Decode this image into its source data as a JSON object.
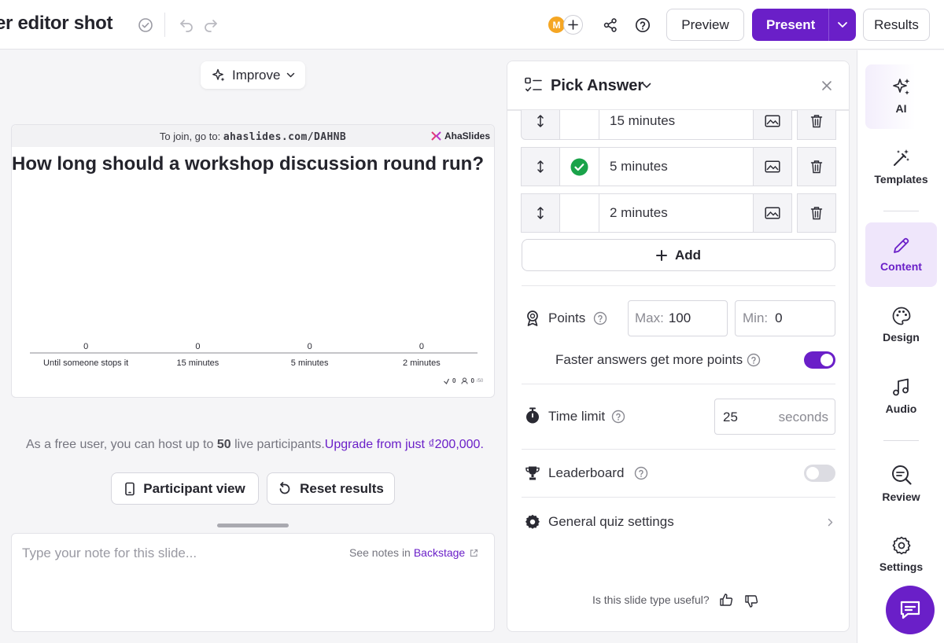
{
  "header": {
    "title": "er editor shot",
    "avatar_initial": "M",
    "preview_label": "Preview",
    "present_label": "Present",
    "results_label": "Results"
  },
  "editor": {
    "improve_label": "Improve",
    "slide": {
      "join_prefix": "To join, go to:",
      "join_url": "ahaslides.com/DAHNB",
      "brand": "AhaSlides",
      "question": "How long should a workshop discussion round run?",
      "stats_votes": "0",
      "stats_people": "0",
      "stats_people_max": "/50"
    },
    "free_note": {
      "prefix": "As a free user, you can host up to",
      "limit": "50",
      "suffix": "live participants.",
      "upgrade": "Upgrade from just ₫200,000."
    },
    "participant_view_label": "Participant view",
    "reset_results_label": "Reset results",
    "notes_placeholder": "Type your note for this slide...",
    "notes_hint": "See notes in",
    "notes_link": "Backstage"
  },
  "chart_data": {
    "type": "bar",
    "categories": [
      "Until someone stops it",
      "15 minutes",
      "5 minutes",
      "2 minutes"
    ],
    "values": [
      0,
      0,
      0,
      0
    ],
    "title": "How long should a workshop discussion round run?"
  },
  "panel": {
    "type_label": "Pick Answer",
    "options": [
      {
        "label": "15 minutes",
        "correct": false
      },
      {
        "label": "5 minutes",
        "correct": true
      },
      {
        "label": "2 minutes",
        "correct": false
      }
    ],
    "add_label": "Add",
    "points_label": "Points",
    "max_prefix": "Max:",
    "max_value": "100",
    "min_prefix": "Min:",
    "min_value": "0",
    "faster_label": "Faster answers get more points",
    "faster_enabled": true,
    "time_limit_label": "Time limit",
    "time_value": "25",
    "time_unit": "seconds",
    "leaderboard_label": "Leaderboard",
    "leaderboard_enabled": false,
    "general_label": "General quiz settings",
    "feedback_label": "Is this slide type useful?"
  },
  "sidebar": {
    "items": [
      {
        "label": "AI",
        "icon": "sparkles-icon"
      },
      {
        "label": "Templates",
        "icon": "magic-wand-icon"
      },
      {
        "label": "Content",
        "icon": "pencil-icon",
        "active": true
      },
      {
        "label": "Design",
        "icon": "palette-icon"
      },
      {
        "label": "Audio",
        "icon": "music-note-icon"
      },
      {
        "label": "Review",
        "icon": "review-search-icon"
      },
      {
        "label": "Settings",
        "icon": "gear-icon"
      }
    ]
  },
  "colors": {
    "accent": "#6a1fc8",
    "correct": "#1aa34a"
  }
}
